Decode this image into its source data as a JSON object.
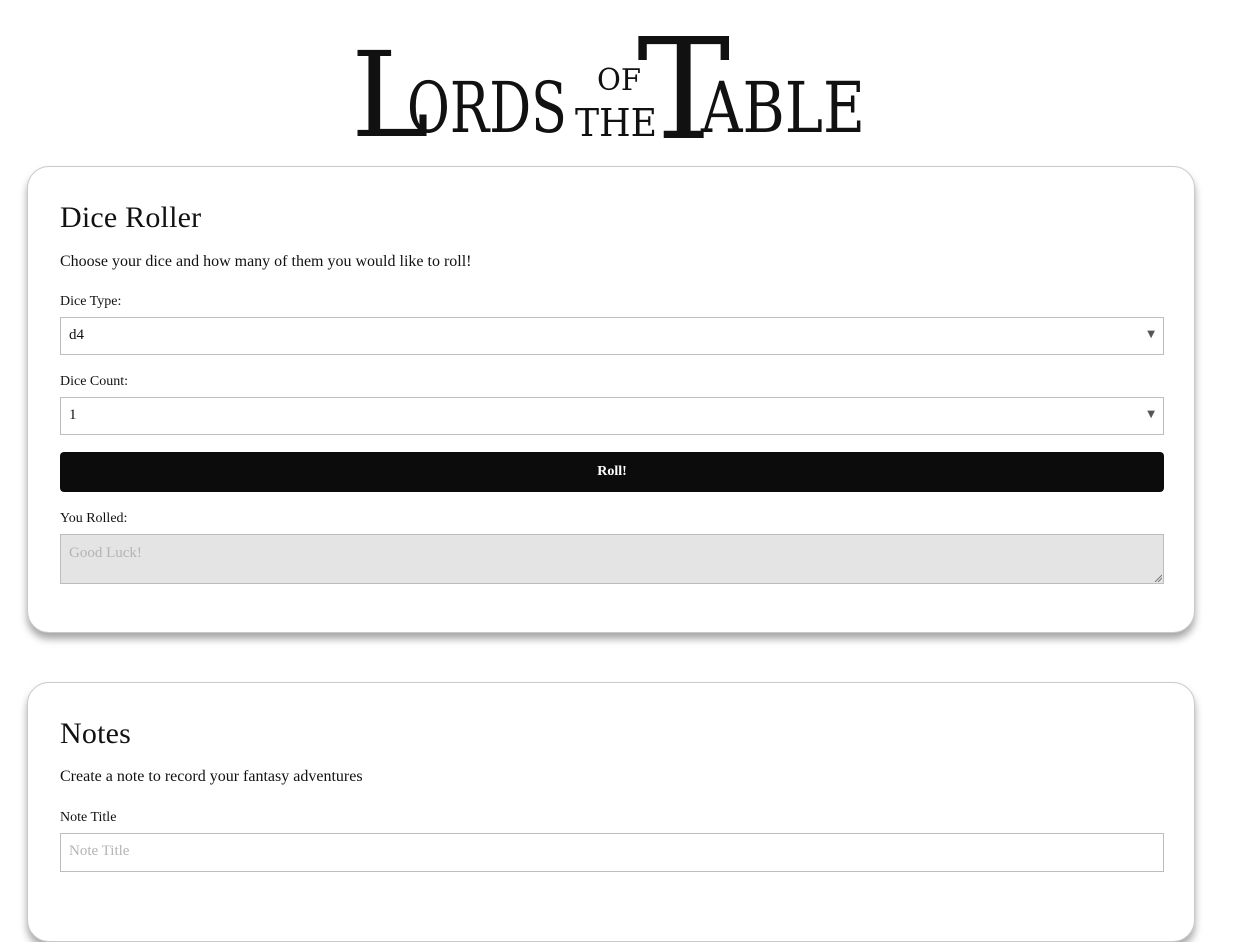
{
  "logo": {
    "word1_initial": "L",
    "word1_rest": "ORDS",
    "of": "OF",
    "the": "THE",
    "word2_initial": "T",
    "word2_rest": "ABLE"
  },
  "dice_roller": {
    "title": "Dice Roller",
    "description": "Choose your dice and how many of them you would like to roll!",
    "dice_type_label": "Dice Type:",
    "dice_type_value": "d4",
    "dice_count_label": "Dice Count:",
    "dice_count_value": "1",
    "roll_button_label": "Roll!",
    "result_label": "You Rolled:",
    "result_placeholder": "Good Luck!"
  },
  "notes": {
    "title": "Notes",
    "description": "Create a note to record your fantasy adventures",
    "note_title_label": "Note Title",
    "note_title_placeholder": "Note Title"
  },
  "icons": {
    "select_caret": "caret-down-icon",
    "resize": "resize-grip-icon"
  }
}
